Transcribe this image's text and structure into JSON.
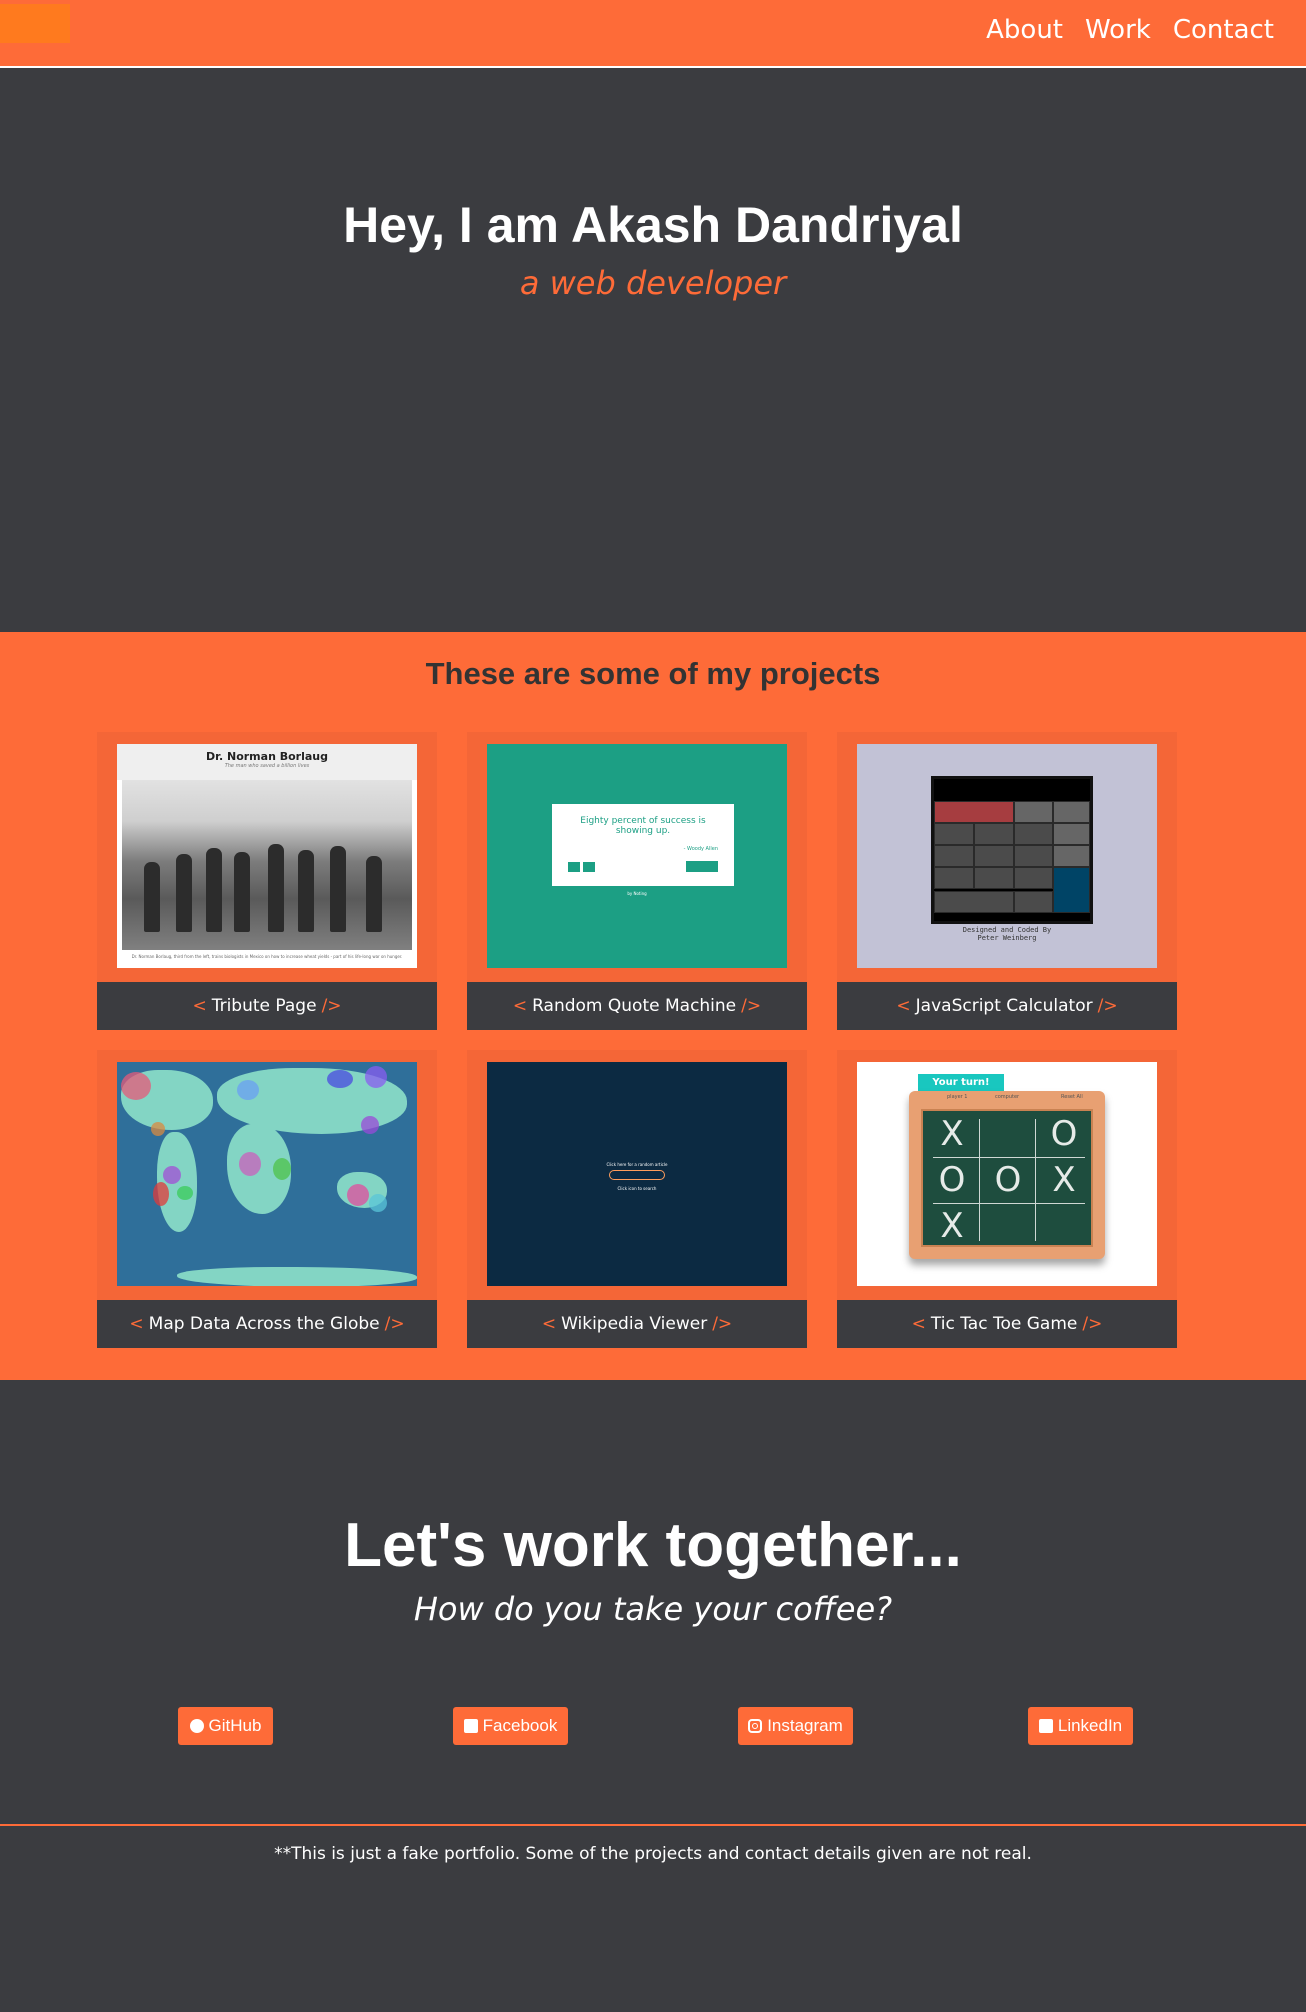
{
  "nav": {
    "links": [
      "About",
      "Work",
      "Contact"
    ]
  },
  "hero": {
    "title": "Hey, I am Akash Dandriyal",
    "subtitle": "a web developer"
  },
  "projects": {
    "heading": "These are some of my projects",
    "items": [
      {
        "title": "Tribute Page",
        "thumb": {
          "title": "Dr. Norman Borlaug",
          "tagline": "The man who saved a billion lives",
          "caption": "Dr. Norman Borlaug, third from the left, trains biologists in Mexico on how to increase wheat yields - part of his life-long war on hunger."
        }
      },
      {
        "title": "Random Quote Machine",
        "thumb": {
          "quote": "Eighty percent of success is showing up.",
          "author": "- Woody Allen",
          "button": "New quote",
          "byline": "by Noting"
        }
      },
      {
        "title": "JavaScript Calculator",
        "thumb": {
          "keys": [
            "AC",
            "/",
            "x",
            "7",
            "8",
            "9",
            "-",
            "4",
            "5",
            "6",
            "+",
            "1",
            "2",
            "3",
            "=",
            "0",
            "."
          ],
          "credit1": "Designed and Coded By",
          "credit2": "Peter Weinberg"
        }
      },
      {
        "title": "Map Data Across the Globe"
      },
      {
        "title": "Wikipedia Viewer",
        "thumb": {
          "line1": "Click here for a random article",
          "line2": "Click icon to search"
        }
      },
      {
        "title": "Tic Tac Toe Game",
        "thumb": {
          "turn": "Your turn!",
          "p1": "player 1",
          "p2": "computer",
          "reset": "Reset All",
          "marks": [
            "X",
            "",
            "O",
            "O",
            "O",
            "X",
            "X",
            "",
            ""
          ]
        }
      }
    ],
    "bracket_open": "<",
    "bracket_close": "/>"
  },
  "contact": {
    "heading": "Let's work together...",
    "subheading": "How do you take your coffee?",
    "buttons": [
      {
        "label": "GitHub",
        "icon": "github-icon"
      },
      {
        "label": "Facebook",
        "icon": "facebook-icon"
      },
      {
        "label": "Instagram",
        "icon": "instagram-icon"
      },
      {
        "label": "LinkedIn",
        "icon": "linkedin-icon"
      }
    ]
  },
  "footer": {
    "text": "**This is just a fake portfolio. Some of the projects and contact details given are not real."
  },
  "colors": {
    "accent": "#fe6b38",
    "background": "#3b3c40"
  }
}
